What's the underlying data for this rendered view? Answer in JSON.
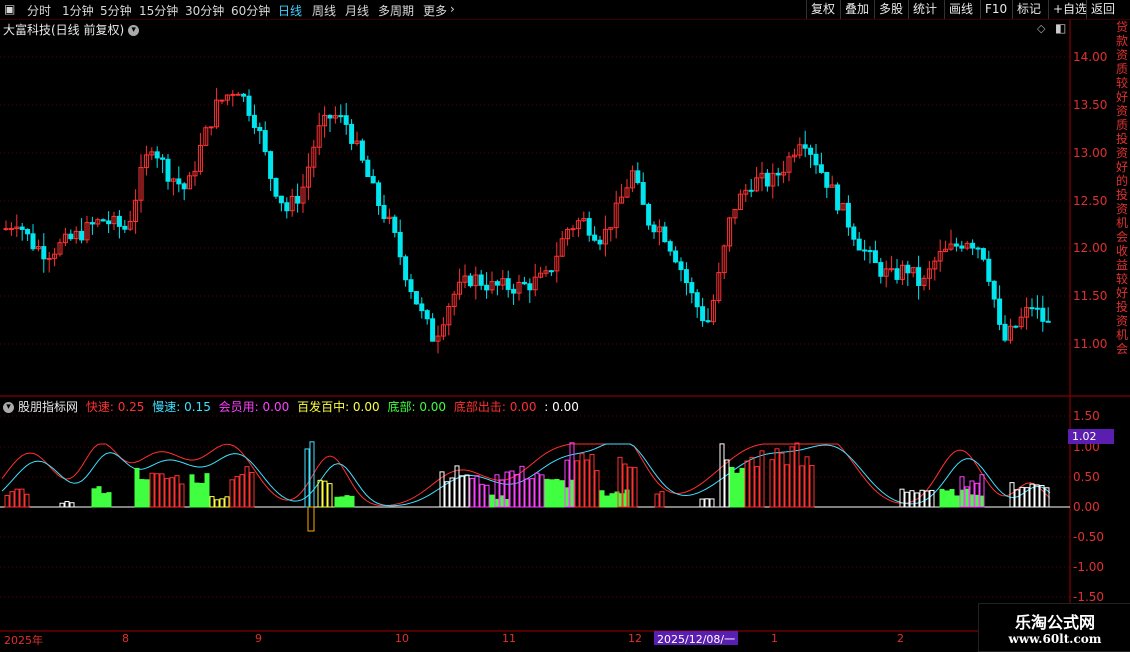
{
  "toolbar": {
    "periods": [
      "分时",
      "1分钟",
      "5分钟",
      "15分钟",
      "30分钟",
      "60分钟",
      "日线",
      "周线",
      "月线",
      "多周期",
      "更多"
    ],
    "active_period": "日线",
    "right_buttons": [
      "复权",
      "叠加",
      "多股",
      "统计",
      "画线",
      "F10",
      "标记",
      "+自选",
      "返回"
    ]
  },
  "main_chart": {
    "title": "大富科技(日线 前复权)",
    "y_labels": [
      "14.00",
      "13.50",
      "13.00",
      "12.50",
      "12.00",
      "11.50",
      "11.00"
    ],
    "colors": {
      "up": "#ff3232",
      "down": "#00e5ee",
      "grid": "#5a0000"
    }
  },
  "indicator": {
    "name": "股朋指标网",
    "legend": [
      {
        "label": "快速: 0.25",
        "color": "#ff3030"
      },
      {
        "label": "慢速: 0.15",
        "color": "#40e0ff"
      },
      {
        "label": "会员用: 0.00",
        "color": "#ff40ff"
      },
      {
        "label": "百发百中: 0.00",
        "color": "#ffff40"
      },
      {
        "label": "底部: 0.00",
        "color": "#40ff40"
      },
      {
        "label": "底部出击: 0.00",
        "color": "#ff3030"
      },
      {
        "label": ": 0.00",
        "color": "#ffffff"
      }
    ],
    "y_labels": [
      "1.50",
      "1.00",
      "0.50",
      "0.00",
      "-0.50",
      "-1.00",
      "-1.50"
    ],
    "current_value": "1.02"
  },
  "x_axis": {
    "labels": [
      "2025年",
      "8",
      "9",
      "10",
      "11",
      "12",
      "1",
      "2"
    ],
    "cursor_date": "2025/12/08/一"
  },
  "side_chars": "贷款资质较好资质投资好的投资机会收益较好投资机会",
  "watermark": {
    "line1": "乐淘公式网",
    "line2": "www.60lt.com"
  }
}
